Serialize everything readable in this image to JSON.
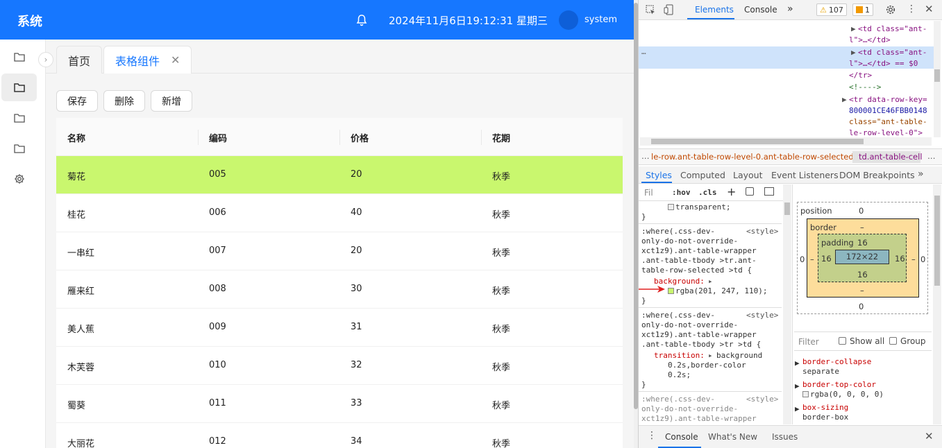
{
  "header": {
    "app_title": "系统",
    "datetime": "2024年11月6日19:12:31 星期三",
    "username": "system"
  },
  "sidebar": {
    "items": [
      {
        "icon": "folder-icon"
      },
      {
        "icon": "folder-icon",
        "active": true
      },
      {
        "icon": "folder-icon"
      },
      {
        "icon": "folder-icon"
      },
      {
        "icon": "gear-icon"
      }
    ]
  },
  "tabs": [
    {
      "label": "首页"
    },
    {
      "label": "表格组件",
      "active": true,
      "close": "✕"
    }
  ],
  "toolbar": {
    "save": "保存",
    "delete": "删除",
    "add": "新增"
  },
  "table": {
    "columns": [
      "名称",
      "编码",
      "价格",
      "花期"
    ],
    "rows": [
      [
        "菊花",
        "005",
        "20",
        "秋季"
      ],
      [
        "桂花",
        "006",
        "40",
        "秋季"
      ],
      [
        "一串红",
        "007",
        "20",
        "秋季"
      ],
      [
        "雁来红",
        "008",
        "30",
        "秋季"
      ],
      [
        "美人蕉",
        "009",
        "31",
        "秋季"
      ],
      [
        "木芙蓉",
        "010",
        "32",
        "秋季"
      ],
      [
        "蜀葵",
        "011",
        "33",
        "秋季"
      ],
      [
        "大丽花",
        "012",
        "34",
        "秋季"
      ]
    ],
    "selected_row": 0,
    "selected_color": "#c9f76e"
  },
  "devtools": {
    "tabs": [
      "Elements",
      "Console"
    ],
    "more": "»",
    "warnings": "107",
    "errors": "1",
    "elements_lines": [
      {
        "text": "<td class=\"ant-"
      },
      {
        "text": "l\">…</td>"
      },
      {
        "text": "<td class=\"ant-"
      },
      {
        "text": "l\">…</td> == $0"
      },
      {
        "text": "</tr>"
      },
      {
        "text": "<!---->"
      },
      {
        "text": "<tr data-row-key="
      },
      {
        "text": "800001CE46FBB0148"
      },
      {
        "text": "class=\"ant-table-"
      },
      {
        "text": "le-row-level-0\">"
      }
    ],
    "ellipsis": "…",
    "breadcrumb_1": "le-row.ant-table-row-level-0.ant-table-row-selected",
    "breadcrumb_2": "td.ant-table-cell",
    "subtabs": [
      "Styles",
      "Computed",
      "Layout",
      "Event Listeners",
      "DOM Breakpoints"
    ],
    "filter_placeholder": "Fil",
    "hov": ":hov",
    "cls": ".cls",
    "rules": [
      {
        "lines": [
          "transparent;",
          "}"
        ]
      },
      {
        "selector": [
          ":where(.css-dev-",
          "only-do-not-override-",
          "xct1z9).ant-table-wrapper",
          ".ant-table-tbody >tr.ant-",
          "table-row-selected >td {"
        ],
        "source": "<style>",
        "prop": "background:",
        "value": "rgba(201, 247, 110);",
        "swatch": "#c9f76e"
      },
      {
        "selector": [
          ":where(.css-dev-",
          "only-do-not-override-",
          "xct1z9).ant-table-wrapper",
          ".ant-table-tbody >tr >td {"
        ],
        "source": "<style>",
        "prop": "transition:",
        "value_lines": [
          "background",
          "0.2s,border-color",
          "0.2s;"
        ]
      },
      {
        "selector": [
          ":where(.css-dev-",
          "only-do-not-override-",
          "xct1z9).ant-table-wrapper"
        ],
        "source": "<style>"
      }
    ],
    "box_model": {
      "position_label": "position",
      "position": "0",
      "border_label": "border",
      "border": "–",
      "padding_label": "padding",
      "padding": "16",
      "content": "172×22",
      "margin_side": "0"
    },
    "computed_filter": "Filter",
    "show_all": "Show all",
    "group": "Group",
    "computed": [
      {
        "prop": "border-collapse",
        "value": "separate"
      },
      {
        "prop": "border-top-color",
        "value": "rgba(0, 0, 0, 0)"
      },
      {
        "prop": "box-sizing",
        "value": "border-box"
      }
    ],
    "drawer_tabs": [
      "Console",
      "What's New",
      "Issues"
    ]
  }
}
